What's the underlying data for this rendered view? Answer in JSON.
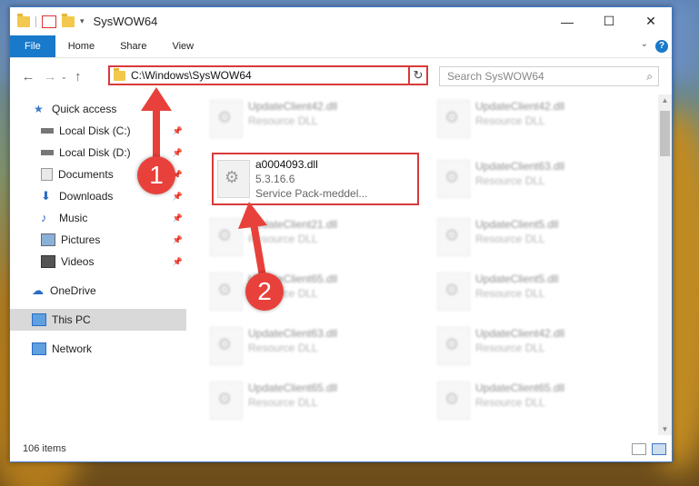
{
  "window": {
    "title": "SysWOW64",
    "minimize": "—",
    "maximize": "☐",
    "close": "✕"
  },
  "ribbon": {
    "tabs": [
      "File",
      "Home",
      "Share",
      "View"
    ],
    "help": "?"
  },
  "nav": {
    "back": "←",
    "forward": "→",
    "up": "↑"
  },
  "address": {
    "path": "C:\\Windows\\SysWOW64",
    "refresh": "↻",
    "dropdown": "⌄"
  },
  "search": {
    "placeholder": "Search SysWOW64",
    "icon": "⌕"
  },
  "sidebar": {
    "items": [
      {
        "label": "Quick access",
        "icon": "star-icon"
      },
      {
        "label": "Local Disk (C:)",
        "icon": "drive-icon",
        "pinned": true
      },
      {
        "label": "Local Disk (D:)",
        "icon": "drive-icon",
        "pinned": true
      },
      {
        "label": "Documents",
        "icon": "documents-icon",
        "pinned": true
      },
      {
        "label": "Downloads",
        "icon": "downloads-icon",
        "pinned": true
      },
      {
        "label": "Music",
        "icon": "music-icon",
        "pinned": true
      },
      {
        "label": "Pictures",
        "icon": "pictures-icon",
        "pinned": true
      },
      {
        "label": "Videos",
        "icon": "videos-icon",
        "pinned": true
      },
      {
        "label": "OneDrive",
        "icon": "cloud-icon"
      },
      {
        "label": "This PC",
        "icon": "pc-icon",
        "selected": true
      },
      {
        "label": "Network",
        "icon": "network-icon"
      }
    ]
  },
  "files": {
    "highlighted": {
      "name": "a0004093.dll",
      "version": "5.3.16.6",
      "description": "Service Pack-meddel..."
    },
    "left": [
      {
        "name": "UpdateClient42.dll",
        "description": "Resource DLL"
      },
      {
        "name": "UpdateClient21.dll",
        "description": "Resource DLL"
      },
      {
        "name": "UpdateClient65.dll",
        "description": "Resource DLL"
      },
      {
        "name": "UpdateClient63.dll",
        "description": "Resource DLL"
      },
      {
        "name": "UpdateClient65.dll",
        "description": "Resource DLL"
      }
    ],
    "right": [
      {
        "name": "UpdateClient42.dll",
        "description": "Resource DLL"
      },
      {
        "name": "UpdateClient63.dll",
        "description": "Resource DLL"
      },
      {
        "name": "UpdateClient5.dll",
        "description": "Resource DLL"
      },
      {
        "name": "UpdateClient5.dll",
        "description": "Resource DLL"
      },
      {
        "name": "UpdateClient42.dll",
        "description": "Resource DLL"
      },
      {
        "name": "UpdateClient65.dll",
        "description": "Resource DLL"
      }
    ]
  },
  "status": {
    "item_count": "106 items"
  },
  "callouts": [
    "1",
    "2"
  ],
  "colors": {
    "accent": "#1979ca",
    "highlight": "#d9393a",
    "callout": "#e8413b"
  }
}
